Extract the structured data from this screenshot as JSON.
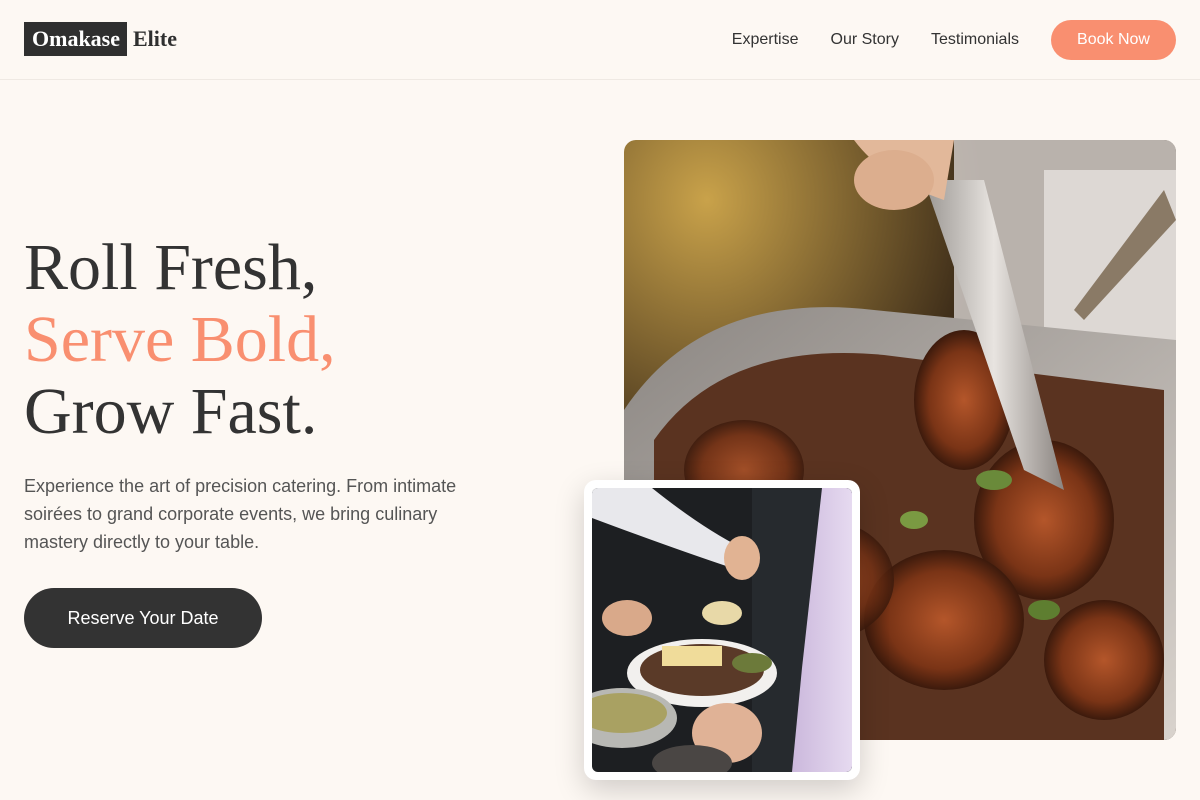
{
  "brand": {
    "logo_box": "Omakase",
    "logo_text": "Elite"
  },
  "nav": {
    "items": [
      "Expertise",
      "Our Story",
      "Testimonials"
    ],
    "cta": "Book Now"
  },
  "hero": {
    "title_line1": "Roll Fresh,",
    "title_line2": "Serve Bold,",
    "title_line3": "Grow Fast.",
    "description": "Experience the art of precision catering. From intimate soirées to grand corporate events, we bring culinary mastery directly to your table.",
    "cta": "Reserve Your Date"
  },
  "colors": {
    "background": "#fdf8f3",
    "accent": "#f98f70",
    "dark": "#333333"
  }
}
